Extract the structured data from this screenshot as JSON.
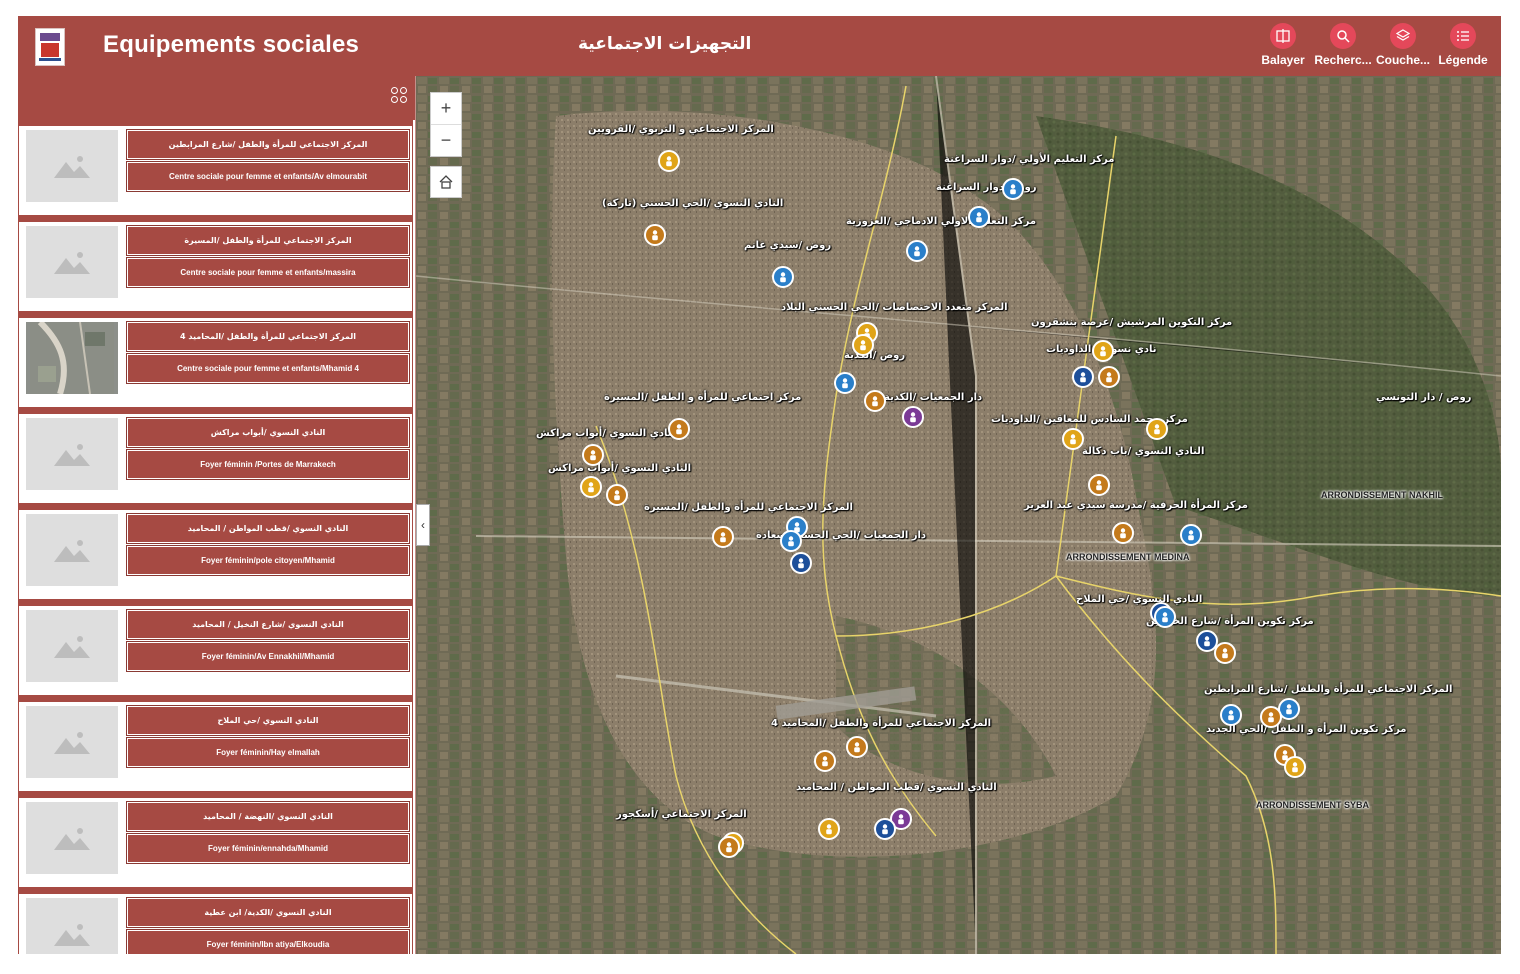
{
  "header": {
    "title": "Equipements sociales",
    "title_ar": "التجهيزات الاجتماعية",
    "tools": [
      {
        "label": "Balayer",
        "icon": "swipe-icon"
      },
      {
        "label": "Recherc...",
        "icon": "search-icon"
      },
      {
        "label": "Couche...",
        "icon": "layers-icon"
      },
      {
        "label": "Légende",
        "icon": "legend-icon"
      }
    ]
  },
  "cards": [
    {
      "ar": "المركز الاجتماعي للمرأة والطفل  /شارع المرابطين",
      "fr": "Centre sociale pour femme et enfants/Av elmourabit",
      "photo": false
    },
    {
      "ar": "المركز الاجتماعي للمرأة والطفل  /المسيرة",
      "fr": "Centre sociale pour femme et enfants/massira",
      "photo": false
    },
    {
      "ar": "المركز الاجتماعي للمرأة والطفل  /المحاميد 4",
      "fr": "Centre sociale pour femme et enfants/Mhamid 4",
      "photo": true
    },
    {
      "ar": "النادي النسوي /أبواب مراكش",
      "fr": "Foyer féminin  /Portes de Marrakech",
      "photo": false
    },
    {
      "ar": "النادي النسوي  /قطب المواطن / المحاميد",
      "fr": "Foyer féminin/pole citoyen/Mhamid",
      "photo": false
    },
    {
      "ar": "النادي النسوي  /شارع النخيل / المحاميد",
      "fr": "Foyer féminin/Av Ennakhil/Mhamid",
      "photo": false
    },
    {
      "ar": "النادي النسوي  /حي الملاح",
      "fr": "Foyer féminin/Hay elmallah",
      "photo": false
    },
    {
      "ar": "النادي النسوي  /النهضة / المحاميد",
      "fr": "Foyer féminin/ennahda/Mhamid",
      "photo": false
    },
    {
      "ar": "النادي النسوي  /الكدية/ ابن عطية",
      "fr": "Foyer féminin/Ibn atiya/Elkoudia",
      "photo": false
    }
  ],
  "map": {
    "zoom_in": "+",
    "zoom_out": "−",
    "collapse": "‹",
    "districts": [
      {
        "name": "ARRONDISSEMENT NAKHIL"
      },
      {
        "name": "ARRONDISSEMENT MEDINA"
      },
      {
        "name": "ARRONDISSEMENT SYBA"
      }
    ],
    "labels": [
      "المركز الاجتماعي و التربوي /القرويين",
      "مركز التعليم الأولي /دوار السراغنة",
      "روض /دوار السراغنة",
      "النادي النسوي /الحي الحسني (تاركة)",
      "مركز التعليم الاولي الادماجي /العزوزية",
      "روض /سيدي غانم",
      "المركز متعدد الاختصاصات /الحي الحسني البلاد",
      "مركز التكوين المرشيش /عرصة بنشقرون",
      "نادي نسوي / الداوديات",
      "روض /الكدية",
      "مركز اجتماعي للمرأة و الطفل /المسيرة",
      "دار الجمعيات /الكدية",
      "النادي النسوي /أبواب مراكش",
      "مركز محمد السادس للمعاقين /الداوديات",
      "روض / دار التونسي",
      "النادي النسوي /باب دكالة",
      "النادي النسوي /أبواب مراكش",
      "مركز المرأة الحرفية /مدرسة سيدي عبد العزيز",
      "المركز الاجتماعي للمرأة والطفل /المسيرة",
      "دار الجمعيات /الحي الحسني سعادة",
      "النادي النسوي /حي الملاح",
      "مركز تكوين المرأة /شارع الخدادين",
      "المركز الاجتماعي للمرأة والطفل /شارع المرابطين",
      "مركز تكوين المرأة و الطفل /الحي الجديد",
      "المركز الاجتماعي للمرأة والطفل /المحاميد 4",
      "النادي النسوي /قطب المواطن / المحاميد",
      "المركز الاجتماعي /أسكجور"
    ]
  }
}
